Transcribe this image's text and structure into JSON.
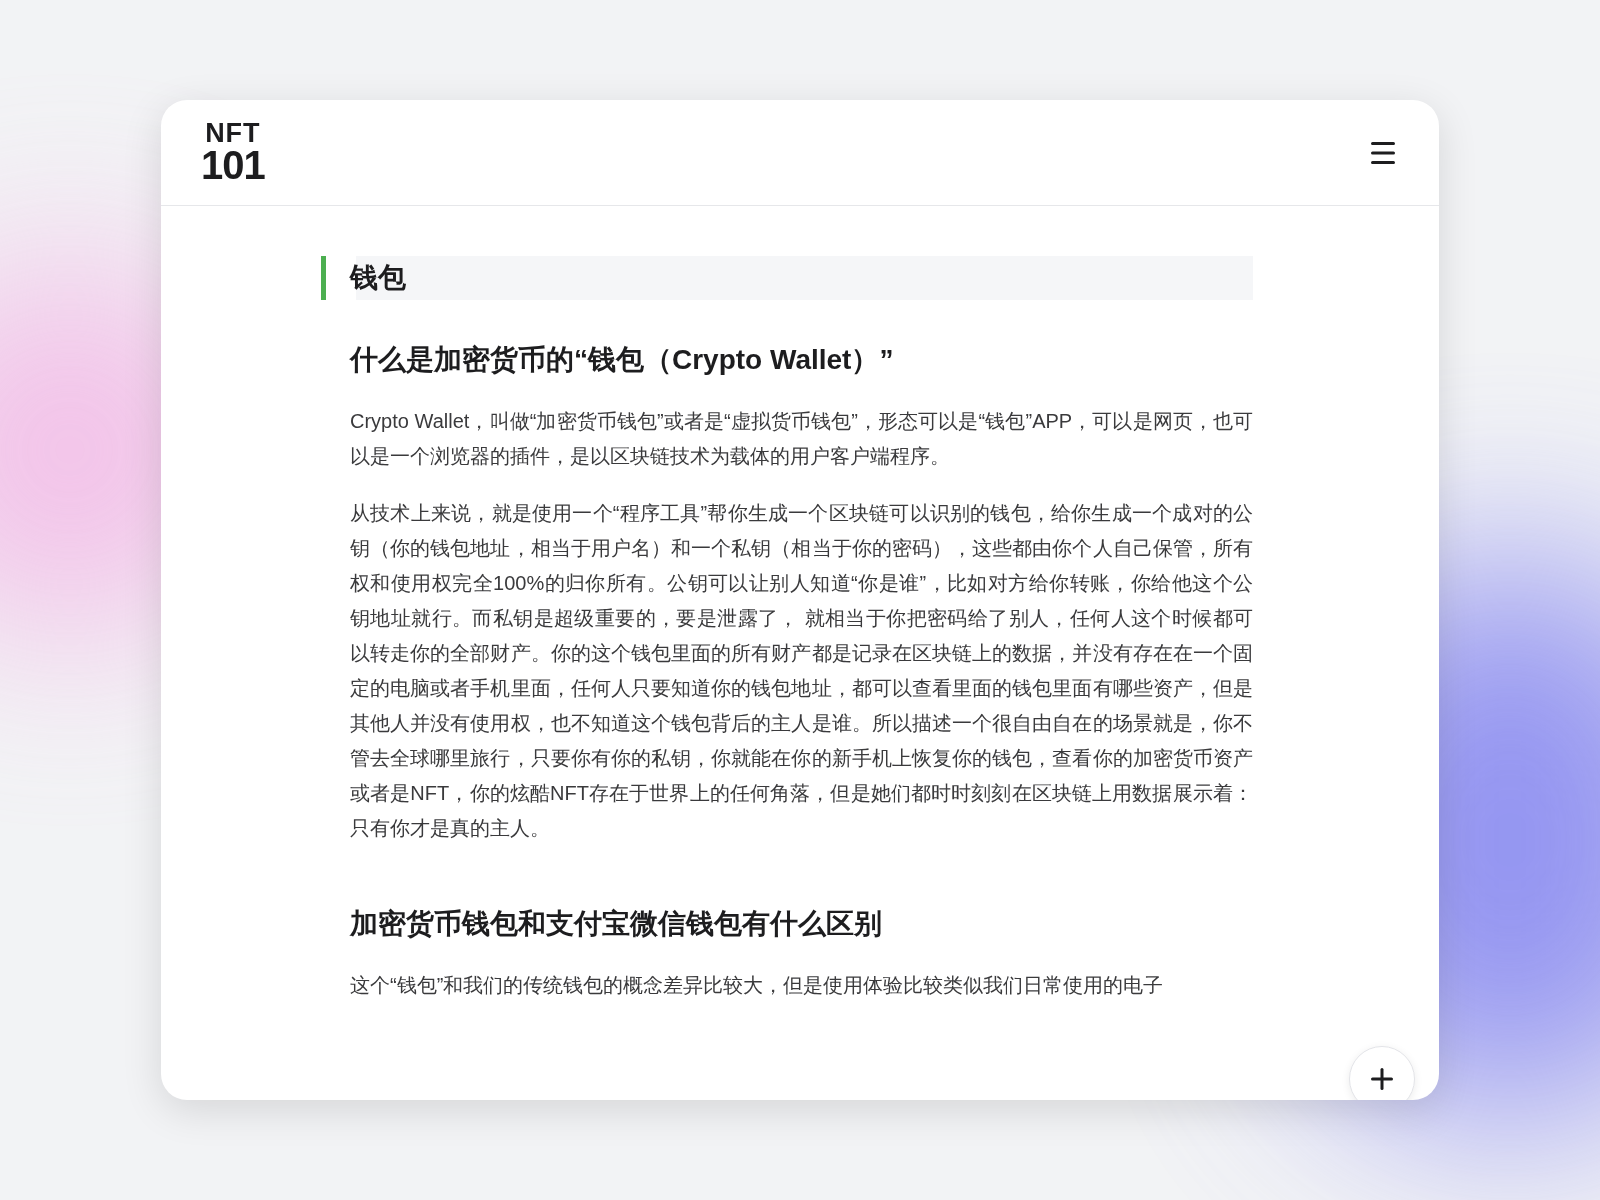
{
  "header": {
    "logo": [
      "NFT",
      "101"
    ]
  },
  "page_title": "钱包",
  "sections": [
    {
      "heading": "什么是加密货币的“钱包（Crypto Wallet）”",
      "paragraphs": [
        "Crypto Wallet，叫做“加密货币钱包”或者是“虚拟货币钱包”，形态可以是“钱包”APP，可以是网页，也可以是一个浏览器的插件，是以区块链技术为载体的用户客户端程序。",
        "从技术上来说，就是使用一个“程序工具”帮你生成一个区块链可以识别的钱包，给你生成一个成对的公钥（你的钱包地址，相当于用户名）和一个私钥（相当于你的密码），这些都由你个人自己保管，所有权和使用权完全100%的归你所有。公钥可以让别人知道“你是谁”，比如对方给你转账，你给他这个公钥地址就行。而私钥是超级重要的，要是泄露了， 就相当于你把密码给了别人，任何人这个时候都可以转走你的全部财产。你的这个钱包里面的所有财产都是记录在区块链上的数据，并没有存在在一个固定的电脑或者手机里面，任何人只要知道你的钱包地址，都可以查看里面的钱包里面有哪些资产，但是其他人并没有使用权，也不知道这个钱包背后的主人是谁。所以描述一个很自由自在的场景就是，你不管去全球哪里旅行，只要你有你的私钥，你就能在你的新手机上恢复你的钱包，查看你的加密货币资产或者是NFT，你的炫酷NFT存在于世界上的任何角落，但是她们都时时刻刻在区块链上用数据展示着：只有你才是真的主人。"
      ]
    },
    {
      "heading": "加密货币钱包和支付宝微信钱包有什么区别",
      "paragraphs": [
        "这个“钱包”和我们的传统钱包的概念差异比较大，但是使用体验比较类似我们日常使用的电子"
      ]
    }
  ]
}
